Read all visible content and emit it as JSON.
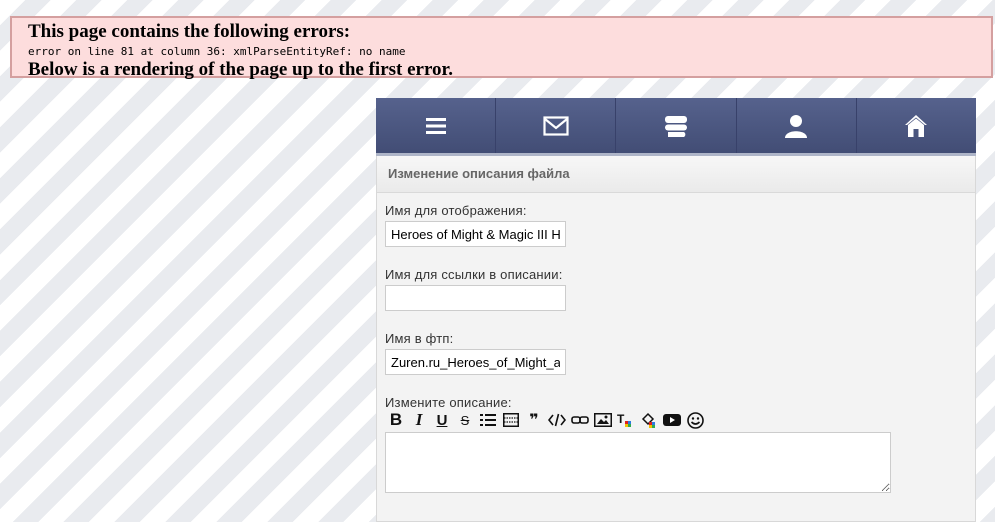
{
  "error": {
    "heading": "This page contains the following errors:",
    "message": "error on line 81 at column 36: xmlParseEntityRef: no name",
    "footer": "Below is a rendering of the page up to the first error."
  },
  "nav": {
    "items": [
      {
        "icon": "menu-icon"
      },
      {
        "icon": "mail-icon"
      },
      {
        "icon": "chat-icon"
      },
      {
        "icon": "user-icon"
      },
      {
        "icon": "home-icon"
      }
    ],
    "bg_color": "#4b5781"
  },
  "panel": {
    "title": "Изменение описания файла"
  },
  "form": {
    "display_name_label": "Имя для отображения:",
    "display_name_value": "Heroes of Might & Magic III Heroes",
    "link_name_label": "Имя для ссылки в описании:",
    "link_name_value": "",
    "ftp_name_label": "Имя в фтп:",
    "ftp_name_value": "Zuren.ru_Heroes_of_Might_and_Magic",
    "description_label": "Измените описание:",
    "description_value": ""
  },
  "toolbar": {
    "buttons": [
      "bold-icon",
      "italic-icon",
      "underline-icon",
      "strikethrough-icon",
      "list-icon",
      "table-icon",
      "quote-icon",
      "code-icon",
      "link-icon",
      "image-icon",
      "text-color-icon",
      "background-color-icon",
      "video-icon",
      "smiley-icon"
    ]
  }
}
